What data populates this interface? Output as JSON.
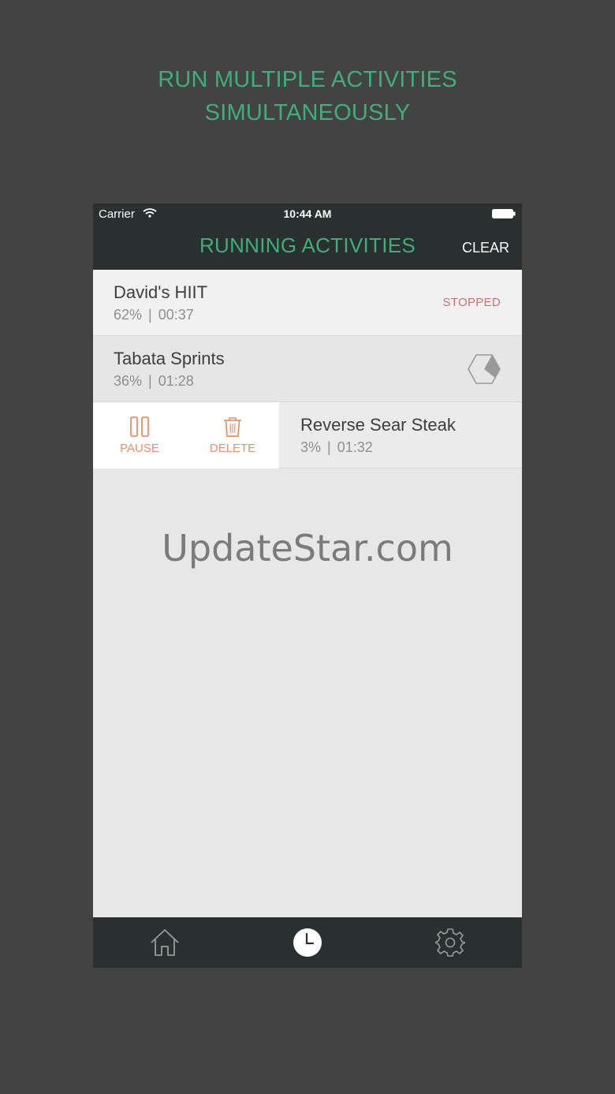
{
  "promo": {
    "line1": "RUN MULTIPLE ACTIVITIES",
    "line2": "SIMULTANEOUSLY"
  },
  "status_bar": {
    "carrier": "Carrier",
    "time": "10:44 AM"
  },
  "header": {
    "title": "RUNNING ACTIVITIES",
    "clear_label": "CLEAR"
  },
  "activities": [
    {
      "name": "David's HIIT",
      "percent": "62%",
      "time": "00:37",
      "status": "STOPPED"
    },
    {
      "name": "Tabata Sprints",
      "percent": "36%",
      "time": "01:28",
      "progress_fraction": 0.36
    },
    {
      "name": "Reverse Sear Steak",
      "percent": "3%",
      "time": "01:32"
    }
  ],
  "swipe_actions": {
    "pause_label": "PAUSE",
    "delete_label": "DELETE"
  },
  "watermark": "UpdateStar.com",
  "tab_bar": {
    "items": [
      {
        "icon": "home-icon"
      },
      {
        "icon": "clock-icon",
        "active": true
      },
      {
        "icon": "gear-icon"
      }
    ]
  },
  "colors": {
    "accent_green": "#3fae79",
    "header_bg": "#2a3030",
    "stopped_red": "#d86d6d",
    "action_orange": "#e8906a",
    "page_bg": "#434343"
  }
}
